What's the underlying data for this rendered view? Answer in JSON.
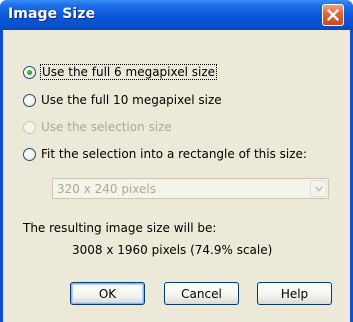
{
  "dialog": {
    "title": "Image Size",
    "close_label": "×"
  },
  "options": [
    {
      "label": "Use the full 6 megapixel size",
      "checked": true,
      "disabled": false
    },
    {
      "label": "Use the full 10 megapixel size",
      "checked": false,
      "disabled": false
    },
    {
      "label": "Use the selection size",
      "checked": false,
      "disabled": true
    },
    {
      "label": "Fit the selection into a rectangle of this size:",
      "checked": false,
      "disabled": false
    }
  ],
  "size_select": {
    "value": "320 x 240 pixels",
    "disabled": true
  },
  "result": {
    "caption": "The resulting image size will be:",
    "value": "3008 x 1960 pixels (74.9% scale)"
  },
  "buttons": {
    "ok_label": "OK",
    "cancel_label": "Cancel",
    "help_label": "Help"
  },
  "icons": {
    "close": "close-icon",
    "dropdown": "chevron-down-icon"
  }
}
